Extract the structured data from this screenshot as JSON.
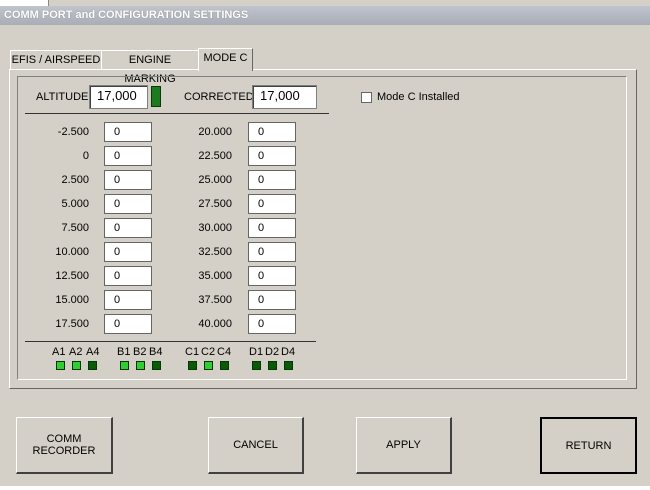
{
  "window": {
    "title": "COMM PORT and CONFIGURATION SETTINGS"
  },
  "tabs": [
    {
      "label": "EFIS / AIRSPEED",
      "active": false
    },
    {
      "label": "ENGINE MARKING",
      "active": false
    },
    {
      "label": "MODE C",
      "active": true
    }
  ],
  "mode_c": {
    "altitude_label": "ALTITUDE",
    "altitude_value": "17,000",
    "altitude_indicator_color": "#1e7a1e",
    "corrected_label": "CORRECTED",
    "corrected_value": "17,000",
    "installed_label": "Mode C Installed",
    "installed_checked": false,
    "left_rows": [
      {
        "label": "-2.500",
        "value": "0"
      },
      {
        "label": "0",
        "value": "0"
      },
      {
        "label": "2.500",
        "value": "0"
      },
      {
        "label": "5.000",
        "value": "0"
      },
      {
        "label": "7.500",
        "value": "0"
      },
      {
        "label": "10.000",
        "value": "0"
      },
      {
        "label": "12.500",
        "value": "0"
      },
      {
        "label": "15.000",
        "value": "0"
      },
      {
        "label": "17.500",
        "value": "0"
      }
    ],
    "right_rows": [
      {
        "label": "20.000",
        "value": "0"
      },
      {
        "label": "22.500",
        "value": "0"
      },
      {
        "label": "25.000",
        "value": "0"
      },
      {
        "label": "27.500",
        "value": "0"
      },
      {
        "label": "30.000",
        "value": "0"
      },
      {
        "label": "32.500",
        "value": "0"
      },
      {
        "label": "35.000",
        "value": "0"
      },
      {
        "label": "37.500",
        "value": "0"
      },
      {
        "label": "40.000",
        "value": "0"
      }
    ],
    "bit_groups": [
      {
        "labels": [
          "A1",
          "A2",
          "A4"
        ],
        "states": [
          "on",
          "on",
          "off"
        ]
      },
      {
        "labels": [
          "B1",
          "B2",
          "B4"
        ],
        "states": [
          "on",
          "on",
          "off"
        ]
      },
      {
        "labels": [
          "C1",
          "C2",
          "C4"
        ],
        "states": [
          "off",
          "on",
          "off"
        ]
      },
      {
        "labels": [
          "D1",
          "D2",
          "D4"
        ],
        "states": [
          "off",
          "off",
          "off"
        ]
      }
    ],
    "led_colors": {
      "on": "#33cc33",
      "off": "#0a5a0a"
    }
  },
  "buttons": {
    "comm_recorder": "COMM\nRECORDER",
    "cancel": "CANCEL",
    "apply": "APPLY",
    "return": "RETURN"
  }
}
